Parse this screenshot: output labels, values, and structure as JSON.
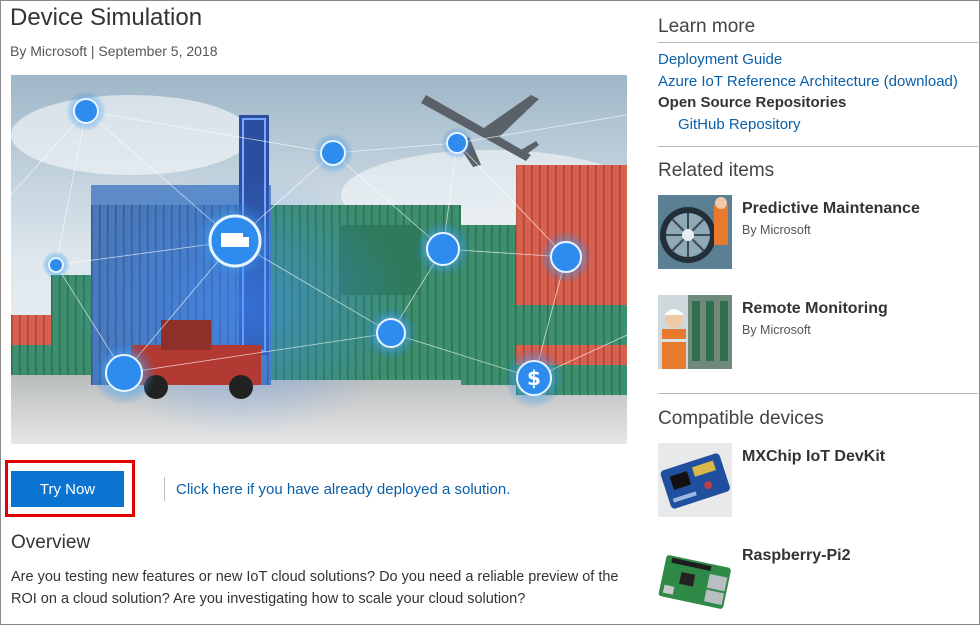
{
  "page": {
    "title": "Device Simulation",
    "byline": "By Microsoft | September 5, 2018"
  },
  "actions": {
    "try_now": "Try Now",
    "deployed_link": "Click here if you have already deployed a solution."
  },
  "overview": {
    "heading": "Overview",
    "text": "Are you testing new features or new IoT cloud solutions? Do you need a reliable preview of the ROI on a cloud solution? Are you investigating how to scale your cloud solution?"
  },
  "learn_more": {
    "heading": "Learn more",
    "links": [
      "Deployment Guide",
      "Azure IoT Reference Architecture (download)"
    ],
    "repos_label": "Open Source Repositories",
    "repo_link": "GitHub Repository"
  },
  "related": {
    "heading": "Related items",
    "items": [
      {
        "title": "Predictive Maintenance",
        "by": "By Microsoft"
      },
      {
        "title": "Remote Monitoring",
        "by": "By Microsoft"
      }
    ]
  },
  "compatible": {
    "heading": "Compatible devices",
    "items": [
      {
        "title": "MXChip IoT DevKit"
      },
      {
        "title": "Raspberry-Pi2"
      }
    ]
  },
  "colors": {
    "link": "#0a5fa8",
    "button": "#0a74d0",
    "highlight": "#e30000"
  }
}
